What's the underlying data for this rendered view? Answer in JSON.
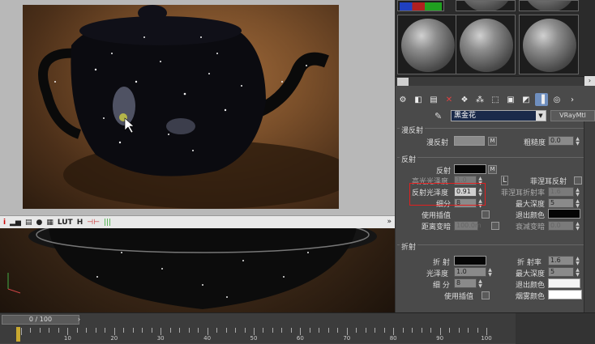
{
  "render_toolbar": {
    "icons": [
      "info-icon",
      "histogram-icon",
      "document-icon",
      "record-icon",
      "grid-icon",
      "lut-icon",
      "h-icon",
      "channel-icon",
      "color-bars-icon"
    ],
    "lut_label": "LUT",
    "h_label": "H",
    "expand_glyph": "»"
  },
  "material": {
    "name": "黑金花",
    "type": "VRayMtl"
  },
  "diffuse": {
    "section_label": "漫反射",
    "diffuse_label": "漫反射",
    "diffuse_color": "#8a8a8a",
    "roughness_label": "粗糙度",
    "roughness_value": "0.0"
  },
  "reflection": {
    "section_label": "反射",
    "reflect_label": "反射",
    "reflect_color": "#050505",
    "hilight_gloss_label": "高光光泽度",
    "hilight_gloss_value": "1.0",
    "lock_label": "L",
    "fresnel_label": "菲涅耳反射",
    "refl_gloss_label": "反射光泽度",
    "refl_gloss_value": "0.91",
    "fresnel_ior_label": "菲涅耳折射率",
    "fresnel_ior_value": "1.6",
    "subdivs_label": "细分",
    "subdivs_value": "8",
    "max_depth_label": "最大深度",
    "max_depth_value": "5",
    "interp_label": "使用插值",
    "exit_color_label": "退出颜色",
    "exit_color": "#050505",
    "dim_dist_label": "距离变暗",
    "dim_dist_value": "100.0m",
    "dim_falloff_label": "衰减变暗",
    "dim_falloff_value": "0.0"
  },
  "refraction": {
    "section_label": "折射",
    "refract_label": "折 射",
    "refract_color": "#050505",
    "ior_label": "折 射率",
    "ior_value": "1.6",
    "gloss_label": "光泽度",
    "gloss_value": "1.0",
    "max_depth_label": "最大深度",
    "max_depth_value": "5",
    "subdivs_label": "细 分",
    "subdivs_value": "8",
    "exit_color_label": "退出颜色",
    "exit_color": "#f5f5f5",
    "interp_label": "使用插值",
    "fog_color_label": "烟雾颜色",
    "fog_color": "#ffffff"
  },
  "timeline": {
    "frame_label": "0 / 100",
    "ticks": [
      "10",
      "20",
      "30",
      "40",
      "50",
      "60",
      "70",
      "80",
      "90",
      "100"
    ]
  },
  "colors": {
    "highlight_box": "#e02020",
    "active_icon": "#6f8fbf"
  }
}
